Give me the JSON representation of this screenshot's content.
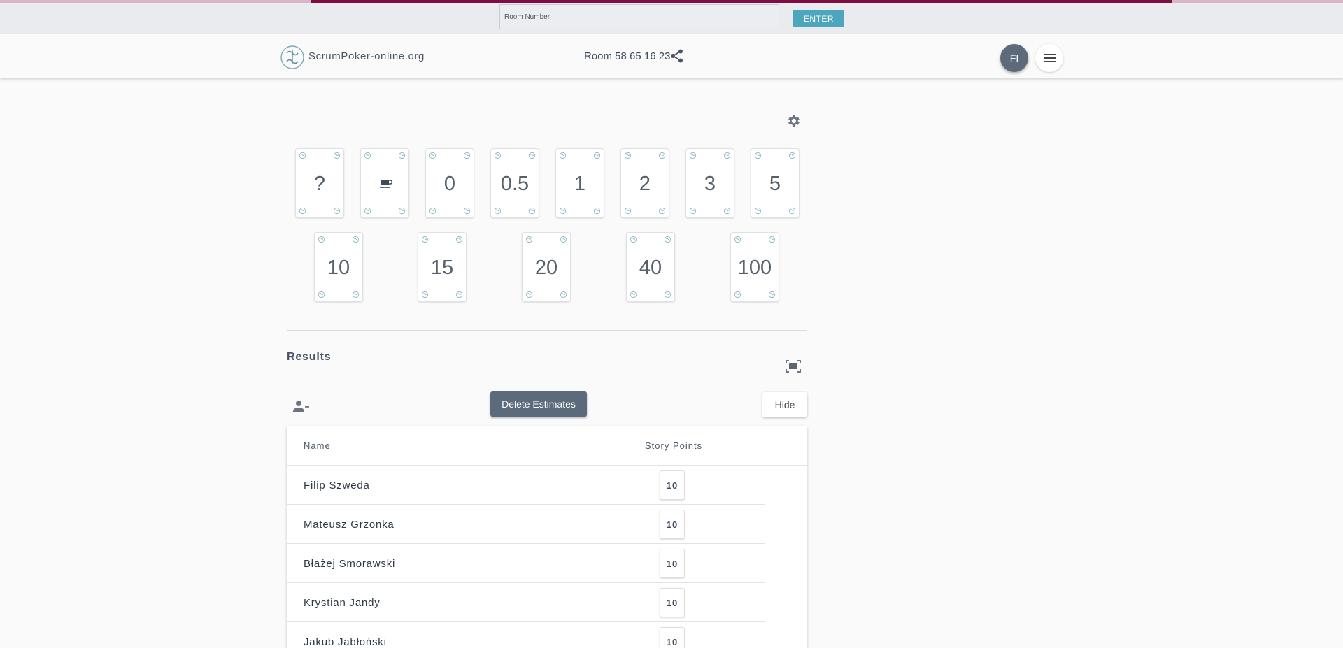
{
  "roombar": {
    "room_input_placeholder": "Room Number",
    "enter_label": "ENTER"
  },
  "header": {
    "brand": "ScrumPoker-online.org",
    "room": "Room 58 65 16 23",
    "avatar_initials": "FI"
  },
  "cards": [
    "?",
    "coffee",
    "0",
    "0.5",
    "1",
    "2",
    "3",
    "5",
    "10",
    "15",
    "20",
    "40",
    "100"
  ],
  "results": {
    "title": "Results",
    "delete_label": "Delete Estimates",
    "hide_label": "Hide",
    "columns": {
      "name": "Name",
      "points": "Story Points"
    },
    "rows": [
      {
        "name": "Filip Szweda",
        "points": "10"
      },
      {
        "name": "Mateusz Grzonka",
        "points": "10"
      },
      {
        "name": "Błażej Smorawski",
        "points": "10"
      },
      {
        "name": "Krystian Jandy",
        "points": "10"
      },
      {
        "name": "Jakub Jabłoński",
        "points": "10"
      }
    ]
  },
  "colors": {
    "accent": "#7d0d42",
    "enter": "#4da6be",
    "primary": "#5c6b7c"
  },
  "icons": [
    "logo-icon",
    "share-icon",
    "menu-icon",
    "gear-icon",
    "coffee-icon",
    "fullscreen-icon",
    "remove-user-icon"
  ]
}
